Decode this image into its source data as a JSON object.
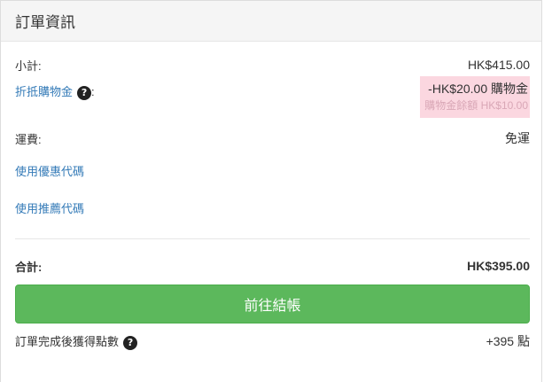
{
  "panel": {
    "title": "訂單資訊"
  },
  "subtotal": {
    "label": "小計:",
    "value": "HK$415.00"
  },
  "store_credit": {
    "label": "折抵購物金",
    "suffix": ":",
    "amount": "-HK$20.00 購物金",
    "balance": "購物金餘額 HK$10.00",
    "help_icon": "question-circle-icon"
  },
  "shipping": {
    "label": "運費:",
    "value": "免運"
  },
  "coupon": {
    "label": "使用優惠代碼"
  },
  "referral": {
    "label": "使用推薦代碼"
  },
  "total": {
    "label": "合計:",
    "value": "HK$395.00"
  },
  "checkout": {
    "label": "前往結帳",
    "color": "#5cb85c"
  },
  "points": {
    "label": "訂單完成後獲得點數",
    "value": "+395 點",
    "help_icon": "question-circle-icon"
  },
  "colors": {
    "link": "#337ab7",
    "credit_highlight": "#fbd7e0",
    "header_bg": "#f5f5f5"
  }
}
